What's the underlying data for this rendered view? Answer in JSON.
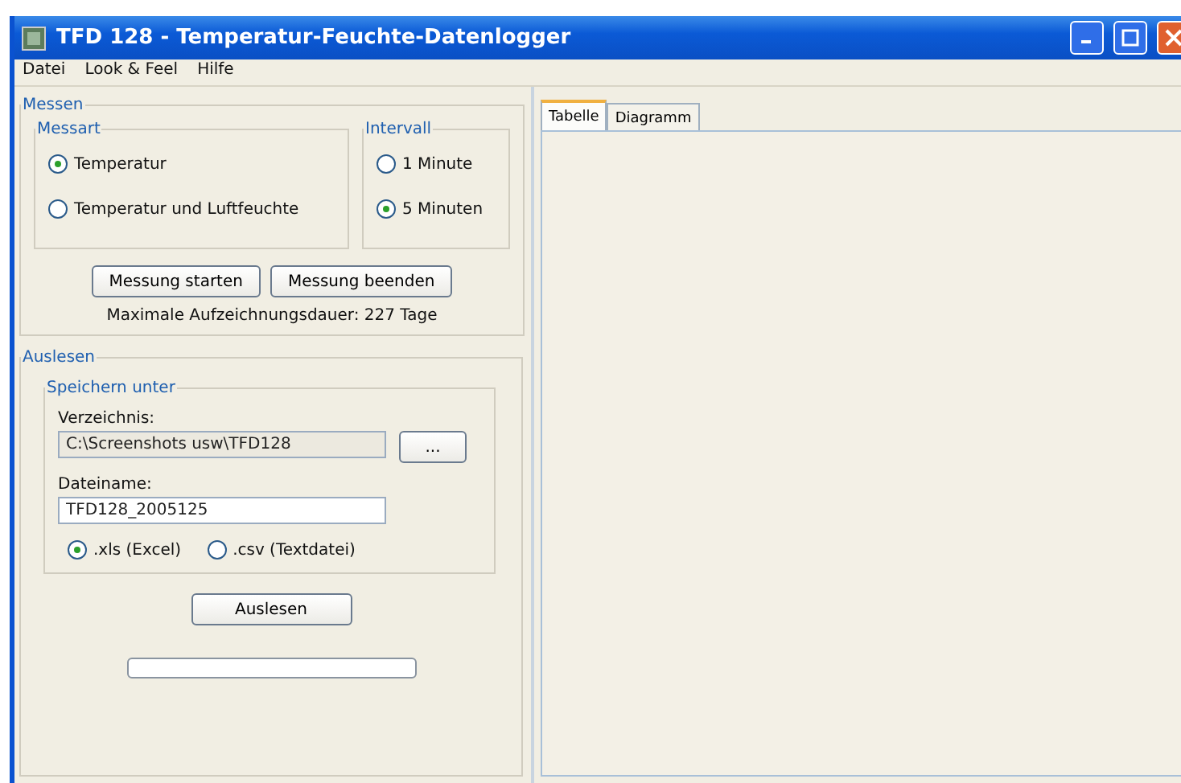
{
  "window": {
    "title": "TFD 128 - Temperatur-Feuchte-Datenlogger"
  },
  "menu": [
    "Datei",
    "Look & Feel",
    "Hilfe"
  ],
  "messen": {
    "title": "Messen",
    "messart": {
      "title": "Messart",
      "options": [
        {
          "label": "Temperatur",
          "selected": true
        },
        {
          "label": "Temperatur und Luftfeuchte",
          "selected": false
        }
      ]
    },
    "intervall": {
      "title": "Intervall",
      "options": [
        {
          "label": "1 Minute",
          "selected": false
        },
        {
          "label": "5 Minuten",
          "selected": true
        }
      ]
    },
    "buttons": [
      "Messung starten",
      "Messung beenden"
    ],
    "info": "Maximale Aufzeichnungsdauer: 227 Tage"
  },
  "auslesen": {
    "title": "Auslesen",
    "speichern": {
      "title": "Speichern unter",
      "directory_label": "Verzeichnis:",
      "directory_value": "C:\\Screenshots usw\\TFD128",
      "browse_button": "...",
      "filename_label": "Dateiname:",
      "filename_value": "TFD128_2005125",
      "formats": [
        {
          "label": ".xls (Excel)",
          "selected": true
        },
        {
          "label": ".csv (Textdatei)",
          "selected": false
        }
      ]
    },
    "button": "Auslesen"
  },
  "tabs": [
    {
      "label": "Tabelle",
      "selected": true
    },
    {
      "label": "Diagramm",
      "selected": false
    }
  ]
}
